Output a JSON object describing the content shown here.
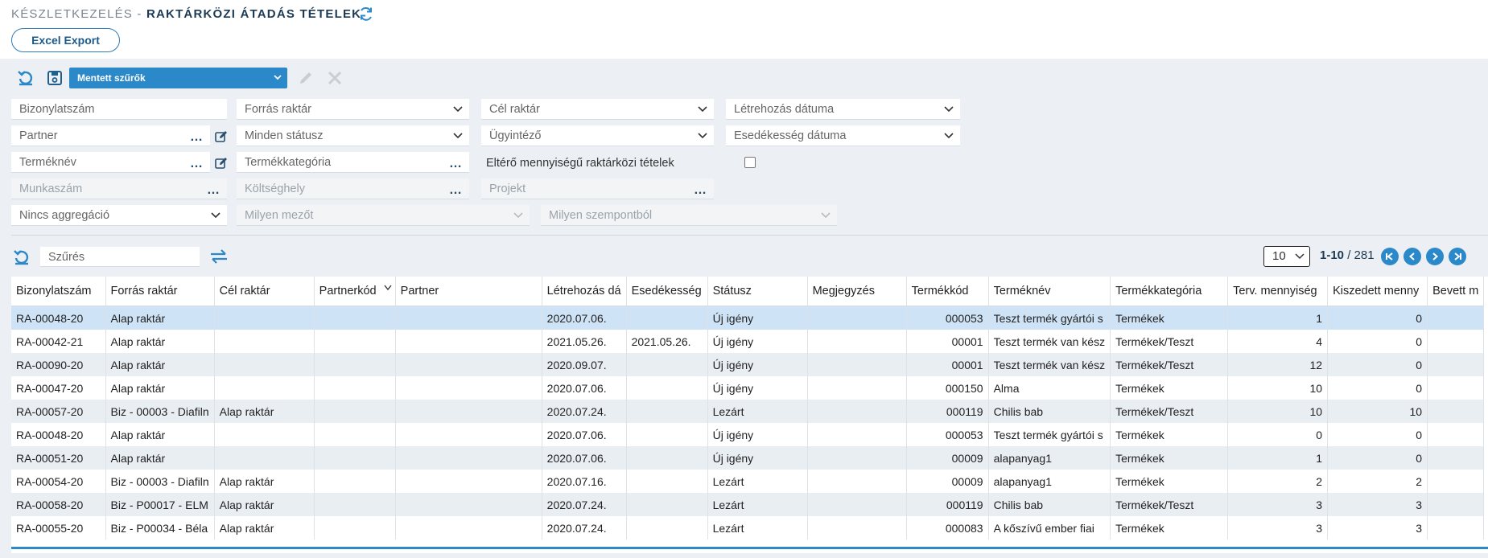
{
  "breadcrumb": {
    "section": "KÉSZLETKEZELÉS -",
    "page": "RAKTÁRKÖZI ÁTADÁS TÉTELEK"
  },
  "toolbar": {
    "excel_export": "Excel Export",
    "saved_filters": "Mentett szűrők"
  },
  "filters": {
    "row1": {
      "bizonylatszam": "Bizonylatszám",
      "forras_raktar": "Forrás raktár",
      "cel_raktar": "Cél raktár",
      "letrehozas_datuma": "Létrehozás dátuma"
    },
    "row2": {
      "partner": "Partner",
      "statusz": "Minden státusz",
      "ugyintezo": "Ügyintéző",
      "esedekesseg_datuma": "Esedékesség dátuma"
    },
    "row3": {
      "termeknev": "Terméknév",
      "termekkategoria": "Termékkategória",
      "elteres_label": "Eltérő mennyiségű raktárközi tételek"
    },
    "row4": {
      "munkaszam": "Munkaszám",
      "koltseghely": "Költséghely",
      "projekt": "Projekt"
    },
    "row5": {
      "aggregacio": "Nincs aggregáció",
      "milyen_mezot": "Milyen mezőt",
      "milyen_szempontbol": "Milyen szempontból"
    }
  },
  "search": {
    "placeholder": "Szűrés"
  },
  "pager": {
    "page_size": "10",
    "range": "1-10",
    "total": "/ 281"
  },
  "colors": {
    "accent": "#2c89c9",
    "panel_bg": "#ecf0f4",
    "selected_row": "#cfe3f6",
    "title": "#1d3a54"
  },
  "table": {
    "columns": [
      "Bizonylatszám",
      "Forrás raktár",
      "Cél raktár",
      "Partnerkód",
      "Partner",
      "Létrehozás dá",
      "Esedékesség",
      "Státusz",
      "Megjegyzés",
      "Termékkód",
      "Terméknév",
      "Termékkategória",
      "Terv. mennyiség",
      "Kiszedett menny",
      "Bevett m"
    ],
    "rows": [
      [
        "RA-00048-20",
        "Alap raktár",
        "",
        "",
        "",
        "2020.07.06.",
        "",
        "Új igény",
        "",
        "000053",
        "Teszt termék gyártói s",
        "Termékek",
        "1",
        "0",
        ""
      ],
      [
        "RA-00042-21",
        "Alap raktár",
        "",
        "",
        "",
        "2021.05.26.",
        "2021.05.26.",
        "Új igény",
        "",
        "00001",
        "Teszt termék van kész",
        "Termékek/Teszt",
        "4",
        "0",
        ""
      ],
      [
        "RA-00090-20",
        "Alap raktár",
        "",
        "",
        "",
        "2020.09.07.",
        "",
        "Új igény",
        "",
        "00001",
        "Teszt termék van kész",
        "Termékek/Teszt",
        "12",
        "0",
        ""
      ],
      [
        "RA-00047-20",
        "Alap raktár",
        "",
        "",
        "",
        "2020.07.06.",
        "",
        "Új igény",
        "",
        "000150",
        "Alma",
        "Termékek",
        "10",
        "0",
        ""
      ],
      [
        "RA-00057-20",
        "Biz - 00003 - Diafiln",
        "Alap raktár",
        "",
        "",
        "2020.07.24.",
        "",
        "Lezárt",
        "",
        "000119",
        "Chilis bab",
        "Termékek/Teszt",
        "10",
        "10",
        ""
      ],
      [
        "RA-00048-20",
        "Alap raktár",
        "",
        "",
        "",
        "2020.07.06.",
        "",
        "Új igény",
        "",
        "000053",
        "Teszt termék gyártói s",
        "Termékek",
        "0",
        "0",
        ""
      ],
      [
        "RA-00051-20",
        "Alap raktár",
        "",
        "",
        "",
        "2020.07.06.",
        "",
        "Új igény",
        "",
        "00009",
        "alapanyag1",
        "Termékek",
        "1",
        "0",
        ""
      ],
      [
        "RA-00054-20",
        "Biz - 00003 - Diafiln",
        "Alap raktár",
        "",
        "",
        "2020.07.16.",
        "",
        "Lezárt",
        "",
        "00009",
        "alapanyag1",
        "Termékek",
        "2",
        "2",
        ""
      ],
      [
        "RA-00058-20",
        "Biz - P00017 - ELM",
        "Alap raktár",
        "",
        "",
        "2020.07.24.",
        "",
        "Lezárt",
        "",
        "000119",
        "Chilis bab",
        "Termékek/Teszt",
        "3",
        "3",
        ""
      ],
      [
        "RA-00055-20",
        "Biz - P00034 - Béla",
        "Alap raktár",
        "",
        "",
        "2020.07.24.",
        "",
        "Lezárt",
        "",
        "000083",
        "A kőszívű ember fiai",
        "Termékek",
        "3",
        "3",
        ""
      ]
    ]
  }
}
